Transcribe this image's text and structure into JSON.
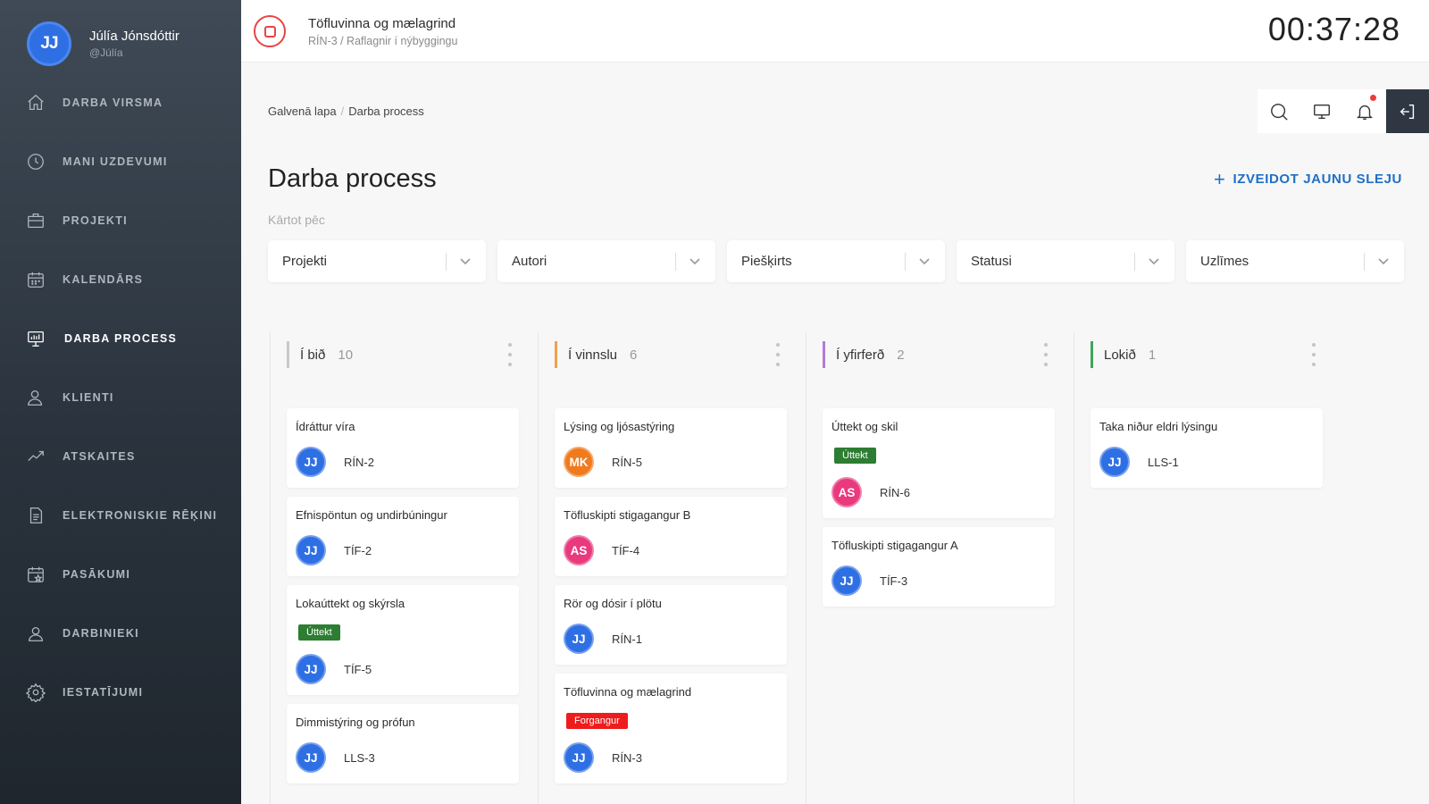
{
  "user": {
    "initials": "JJ",
    "name": "Júlía Jónsdóttir",
    "handle": "@Júlía",
    "color": "#2f6fe4"
  },
  "nav": [
    {
      "label": "DARBA VIRSMA",
      "icon": "home-icon",
      "active": false
    },
    {
      "label": "MANI UZDEVUMI",
      "icon": "clock-icon",
      "active": false
    },
    {
      "label": "PROJEKTI",
      "icon": "briefcase-icon",
      "active": false
    },
    {
      "label": "KALENDĀRS",
      "icon": "calendar-icon",
      "active": false
    },
    {
      "label": "DARBA PROCESS",
      "icon": "presentation-board-icon",
      "active": true
    },
    {
      "label": "KLIENTI",
      "icon": "user-icon",
      "active": false
    },
    {
      "label": "ATSKAITES",
      "icon": "trend-chart-icon",
      "active": false
    },
    {
      "label": "ELEKTRONISKIE RĒĶINI",
      "icon": "document-icon",
      "active": false
    },
    {
      "label": "PASĀKUMI",
      "icon": "calendar-star-icon",
      "active": false
    },
    {
      "label": "DARBINIEKI",
      "icon": "users-icon",
      "active": false
    },
    {
      "label": "IESTATĪJUMI",
      "icon": "gear-icon",
      "active": false
    }
  ],
  "topbar": {
    "task_title": "Töfluvinna og mælagrind",
    "task_sub": "RÍN-3 / Raflagnir í nýbyggingu",
    "timer": "00:37:28"
  },
  "breadcrumb": {
    "home": "Galvenā lapa",
    "separator": "/",
    "current": "Darba process"
  },
  "toolbar": {
    "icons": [
      "search-icon",
      "monitor-icon",
      "bell-icon",
      "logout-icon"
    ],
    "notification": true
  },
  "page": {
    "title": "Darba process",
    "create_button": "IZVEIDOT JAUNU SLEJU",
    "sort_label": "Kārtot pēc"
  },
  "filters": [
    "Projekti",
    "Autori",
    "Piešķirts",
    "Statusi",
    "Uzlīmes"
  ],
  "colors": {
    "accent": "#1f6fc7",
    "tag_green": "#2d7d32",
    "tag_red": "#ee1c1c"
  },
  "columns": [
    {
      "title": "Í bið",
      "count": "10",
      "color": "#c8c8c8",
      "cards": [
        {
          "title": "Ídráttur víra",
          "code": "RÍN-2",
          "avatar": "JJ",
          "avatar_color": "#2f6fe4"
        },
        {
          "title": "Efnispöntun og undirbúningur",
          "code": "TÍF-2",
          "avatar": "JJ",
          "avatar_color": "#2f6fe4"
        },
        {
          "title": "Lokaúttekt og skýrsla",
          "code": "TÍF-5",
          "avatar": "JJ",
          "avatar_color": "#2f6fe4",
          "tag": "Úttekt",
          "tag_color": "#2d7d32"
        },
        {
          "title": "Dimmistýring og prófun",
          "code": "LLS-3",
          "avatar": "JJ",
          "avatar_color": "#2f6fe4"
        }
      ]
    },
    {
      "title": "Í vinnslu",
      "count": "6",
      "color": "#f0a050",
      "cards": [
        {
          "title": "Lýsing og ljósastýring",
          "code": "RÍN-5",
          "avatar": "MK",
          "avatar_color": "#f07a1e"
        },
        {
          "title": "Töfluskipti stigagangur B",
          "code": "TÍF-4",
          "avatar": "AS",
          "avatar_color": "#e83a7d"
        },
        {
          "title": "Rör og dósir í plötu",
          "code": "RÍN-1",
          "avatar": "JJ",
          "avatar_color": "#2f6fe4"
        },
        {
          "title": "Töfluvinna og mælagrind",
          "code": "RÍN-3",
          "avatar": "JJ",
          "avatar_color": "#2f6fe4",
          "tag": "Forgangur",
          "tag_color": "#ee1c1c"
        }
      ]
    },
    {
      "title": "Í yfirferð",
      "count": "2",
      "color": "#b57bd6",
      "cards": [
        {
          "title": "Úttekt og skil",
          "code": "RÍN-6",
          "avatar": "AS",
          "avatar_color": "#e83a7d",
          "tag": "Úttekt",
          "tag_color": "#2d7d32"
        },
        {
          "title": "Töfluskipti stigagangur A",
          "code": "TÍF-3",
          "avatar": "JJ",
          "avatar_color": "#2f6fe4"
        }
      ]
    },
    {
      "title": "Lokið",
      "count": "1",
      "color": "#3da65a",
      "cards": [
        {
          "title": "Taka niður eldri lýsingu",
          "code": "LLS-1",
          "avatar": "JJ",
          "avatar_color": "#2f6fe4"
        }
      ]
    }
  ]
}
